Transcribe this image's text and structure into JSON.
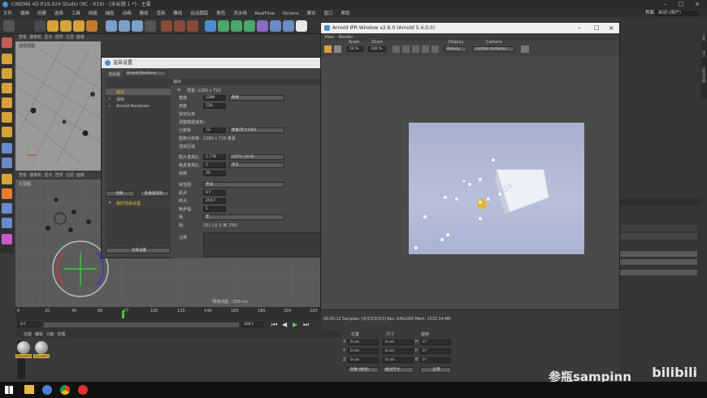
{
  "window": {
    "title": "CINEMA 4D R19.024 Studio (RC - R19) - [未标题 1 *] - 主要"
  },
  "menu": [
    "文件",
    "编辑",
    "创建",
    "选择",
    "工具",
    "网格",
    "捕捉",
    "动画",
    "模拟",
    "渲染",
    "雕刻",
    "运动跟踪",
    "角色",
    "流水线",
    "RealFlow",
    "Octane",
    "脚本",
    "窗口",
    "帮助"
  ],
  "menu_right": {
    "layout_label": "界面",
    "layout_value": "启动 (用户)"
  },
  "viewport_top": {
    "menu": [
      "查看",
      "摄像机",
      "显示",
      "选项",
      "过滤",
      "面板",
      "ProRender"
    ],
    "label": "透视视图"
  },
  "viewport_bottom": {
    "menu": [
      "查看",
      "摄像机",
      "显示",
      "选项",
      "过滤",
      "面板"
    ],
    "label": "右视图",
    "grid_text": "网格间距 : 100 cm"
  },
  "timeline": {
    "ticks": [
      "0",
      "20",
      "40",
      "60",
      "77",
      "100",
      "120",
      "140",
      "160",
      "180",
      "200",
      "220"
    ],
    "frame_start": "0 F",
    "frame_end": "300 F",
    "current": "0 F"
  },
  "materials": {
    "menu": [
      "创建",
      "编辑",
      "功能",
      "纹理"
    ],
    "items": [
      "Standard",
      "Standard"
    ]
  },
  "coords": {
    "headers": [
      "位置",
      "尺寸",
      "旋转"
    ],
    "rows": [
      {
        "axis": "X",
        "pos": "0 cm",
        "size": "0 cm",
        "rot_label": "H",
        "rot": "0 °"
      },
      {
        "axis": "Y",
        "pos": "0 cm",
        "size": "0 cm",
        "rot_label": "P",
        "rot": "0 °"
      },
      {
        "axis": "Z",
        "pos": "0 cm",
        "size": "0 cm",
        "rot_label": "B",
        "rot": "0 °"
      }
    ],
    "mode": "对象 (相对)",
    "size_mode": "绝对尺寸",
    "apply": "应用"
  },
  "render_settings": {
    "title": "渲染设置",
    "renderer_label": "渲染器",
    "renderer": "Arnold Renderer",
    "sections": [
      "输出",
      "保存",
      "Arnold Renderer"
    ],
    "checks": [
      "",
      "✓",
      "✓"
    ],
    "active_section": "输出",
    "effects_button": "效果...",
    "multipass_button": "多通道渲染...",
    "preset": "我的渲染设置",
    "render_button": "渲染设置",
    "header": "输出",
    "preset_line": "预置: 1280 x 720",
    "fields": [
      {
        "label": "宽度",
        "value": "1280",
        "unit": "像素"
      },
      {
        "label": "高度",
        "value": "720",
        "unit": ""
      },
      {
        "label": "锁定比率",
        "value": "",
        "unit": ""
      },
      {
        "label": "调整数据速率",
        "value": "✓",
        "unit": ""
      },
      {
        "label": "分辨率",
        "value": "72",
        "unit": "像素/英寸(DPI)"
      },
      {
        "label": "图像分辨率:",
        "value": "1280 x 720 像素",
        "unit": ""
      },
      {
        "label": "渲染区域",
        "value": "",
        "unit": ""
      },
      {
        "label": "胶片宽高比",
        "value": "1.778",
        "unit": "HDTV (16:9)"
      },
      {
        "label": "像素宽高比",
        "value": "1",
        "unit": "平方"
      },
      {
        "label": "帧频",
        "value": "30",
        "unit": ""
      },
      {
        "label": "帧范围",
        "value": "",
        "unit": "手动"
      },
      {
        "label": "起点",
        "value": "0 F",
        "unit": ""
      },
      {
        "label": "终点",
        "value": "250 F",
        "unit": ""
      },
      {
        "label": "帧步幅",
        "value": "1",
        "unit": ""
      },
      {
        "label": "场",
        "value": "",
        "unit": "无"
      },
      {
        "label": "帧:",
        "value": "251 (从 0 到 250)",
        "unit": ""
      }
    ],
    "notes_label": "注释"
  },
  "arnold_ipr": {
    "title": "Arnold IPR Window v2.6.0 (Arnold 5.4.0.0)",
    "menu": [
      "View",
      "Render"
    ],
    "scale_label": "Scale",
    "scale_value": "50 %",
    "zoom_label": "Zoom",
    "zoom_value": "100 %",
    "display_label": "Display",
    "display_value": "Beauty",
    "camera_label": "Camera",
    "camera_value": "<active camera>",
    "status": "00:00:12  Samples: [4/3/3/3/3/3]  Res: 640x360  Mem: 1533.14 MB"
  },
  "right_panel": {
    "tabs": [
      "对象",
      "场次",
      "内容浏览器",
      "构造"
    ],
    "label": "模式"
  },
  "watermark": {
    "text": "参瓶sampinn",
    "logo": "bilibili"
  },
  "colors": {
    "accent": "#e2b43a",
    "selection": "#4a8fd6",
    "dialog_bg": "#444444"
  }
}
